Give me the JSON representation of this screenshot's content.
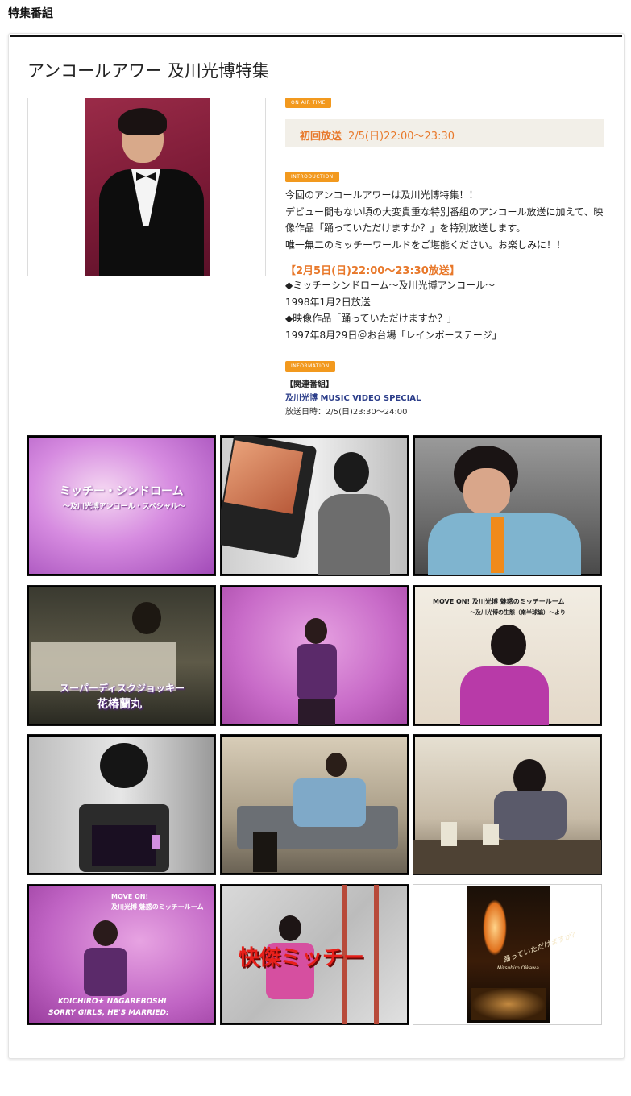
{
  "section_title": "特集番組",
  "page_title": "アンコールアワー 及川光博特集",
  "tags": {
    "on_air": "ON AIR TIME",
    "intro": "INTRODUCTION",
    "info": "INFORMATION"
  },
  "air": {
    "label": "初回放送",
    "value": "2/5(日)22:00〜23:30"
  },
  "introduction": [
    "今回のアンコールアワーは及川光博特集！！",
    "デビュー間もない頃の大変貴重な特別番組のアンコール放送に加えて、映",
    "像作品「踊っていただけますか？」を特別放送します。",
    "唯一無二のミッチーワールドをご堪能ください。お楽しみに！！"
  ],
  "schedule_heading": "【2月5日(日)22:00〜23:30放送】",
  "schedule_lines": [
    "◆ミッチーシンドローム〜及川光博アンコール〜",
    "1998年1月2日放送",
    "◆映像作品「踊っていただけますか？」",
    "1997年8月29日＠お台場「レインボーステージ」"
  ],
  "related": {
    "label": "【関連番組】",
    "link": "及川光博 MUSIC VIDEO SPECIAL",
    "time": "放送日時：2/5(日)23:30〜24:00"
  },
  "thumb_captions": {
    "t1": "ミッチー・シンドローム",
    "t1b": "〜及川光博アンコール・スペシャル〜",
    "t4": "スーパーディスクジョッキー",
    "t4b": "花椿蘭丸",
    "t6a": "MOVE ON!  及川光博  魅惑のミッチールーム",
    "t6b": "〜及川光博の生態（南半球編）〜より",
    "t10a": "MOVE ON!",
    "t10b": "及川光博  魅惑のミッチールーム",
    "t10c": "KOICHIRO★ NAGAREBOSHI",
    "t10d": "SORRY GIRLS, HE'S MARRIED:",
    "t11": "快傑ミッチー",
    "t12a": "踊っていただけますか？",
    "t12b": "Mitsuhiro Oikawa"
  },
  "colors": {
    "accent_orange": "#f2991e",
    "text_orange": "#e8782a",
    "link_blue": "#2c3e8a",
    "air_bg": "#f2efe8"
  }
}
